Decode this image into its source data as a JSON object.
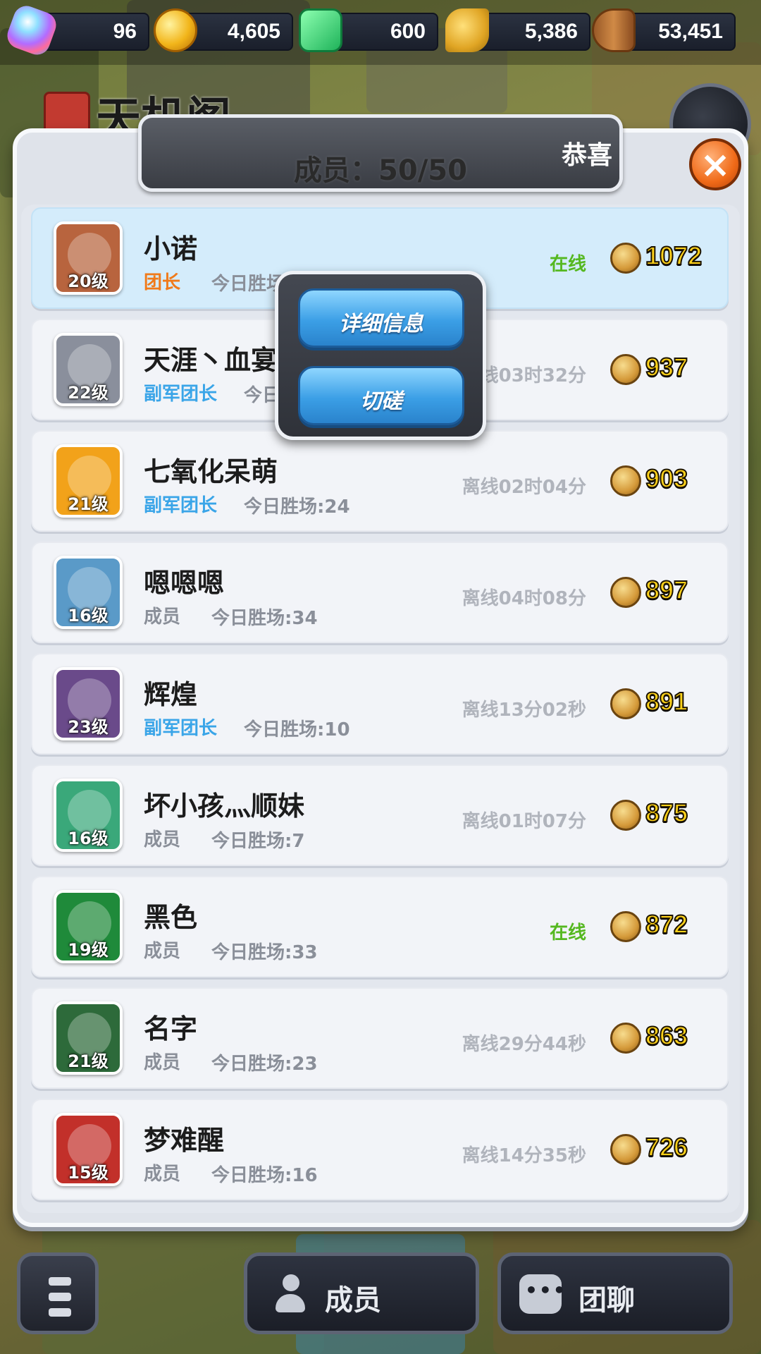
{
  "resources": {
    "gems": "96",
    "coins": "4,605",
    "tickets": "600",
    "wheat": "5,386",
    "wood": "53,451"
  },
  "guild": {
    "name": "天机阁"
  },
  "header": {
    "member_count": "成员：50/50",
    "marquee": "恭喜"
  },
  "popup": {
    "details_label": "详细信息",
    "duel_label": "切磋"
  },
  "members": [
    {
      "name": "小诺",
      "role": "团长",
      "role_type": "leader",
      "level": "20级",
      "wins": "今日胜场:31",
      "status": "在线",
      "online": true,
      "score": "1072",
      "color": "#b8643e"
    },
    {
      "name": "天涯丶血宴",
      "role": "副军团长",
      "role_type": "vice",
      "level": "22级",
      "wins": "今日胜场:",
      "status": "离线03时32分",
      "online": false,
      "score": "937",
      "color": "#8a8f9c"
    },
    {
      "name": "七氧化呆萌",
      "role": "副军团长",
      "role_type": "vice",
      "level": "21级",
      "wins": "今日胜场:24",
      "status": "离线02时04分",
      "online": false,
      "score": "903",
      "color": "#f2a21a"
    },
    {
      "name": "嗯嗯嗯",
      "role": "成员",
      "role_type": "member",
      "level": "16级",
      "wins": "今日胜场:34",
      "status": "离线04时08分",
      "online": false,
      "score": "897",
      "color": "#5a9ac8"
    },
    {
      "name": "辉煌",
      "role": "副军团长",
      "role_type": "vice",
      "level": "23级",
      "wins": "今日胜场:10",
      "status": "离线13分02秒",
      "online": false,
      "score": "891",
      "color": "#6a4a8a"
    },
    {
      "name": "坏小孩灬顺妹",
      "role": "成员",
      "role_type": "member",
      "level": "16级",
      "wins": "今日胜场:7",
      "status": "离线01时07分",
      "online": false,
      "score": "875",
      "color": "#3aa87a"
    },
    {
      "name": "黑色",
      "role": "成员",
      "role_type": "member",
      "level": "19级",
      "wins": "今日胜场:33",
      "status": "在线",
      "online": true,
      "score": "872",
      "color": "#1f8a3a"
    },
    {
      "name": "名字",
      "role": "成员",
      "role_type": "member",
      "level": "21级",
      "wins": "今日胜场:23",
      "status": "离线29分44秒",
      "online": false,
      "score": "863",
      "color": "#2d6a3a"
    },
    {
      "name": "梦难醒",
      "role": "成员",
      "role_type": "member",
      "level": "15级",
      "wins": "今日胜场:16",
      "status": "离线14分35秒",
      "online": false,
      "score": "726",
      "color": "#c2302a"
    }
  ],
  "tabs": {
    "members_label": "成员",
    "chat_label": "团聊"
  },
  "colors": {
    "online": "#55b820",
    "leader": "#f07a1a",
    "vice": "#3aa5e8",
    "score": "#ffd21a"
  },
  "icons": {
    "gems": "gem-icon",
    "coins": "coin-icon",
    "tickets": "ticket-icon",
    "wheat": "wheat-icon",
    "wood": "wood-icon",
    "trophy": "trophy-icon",
    "close": "close-icon",
    "menu": "menu-icon",
    "members": "people-icon",
    "chat": "chat-icon",
    "back": "back-icon"
  }
}
